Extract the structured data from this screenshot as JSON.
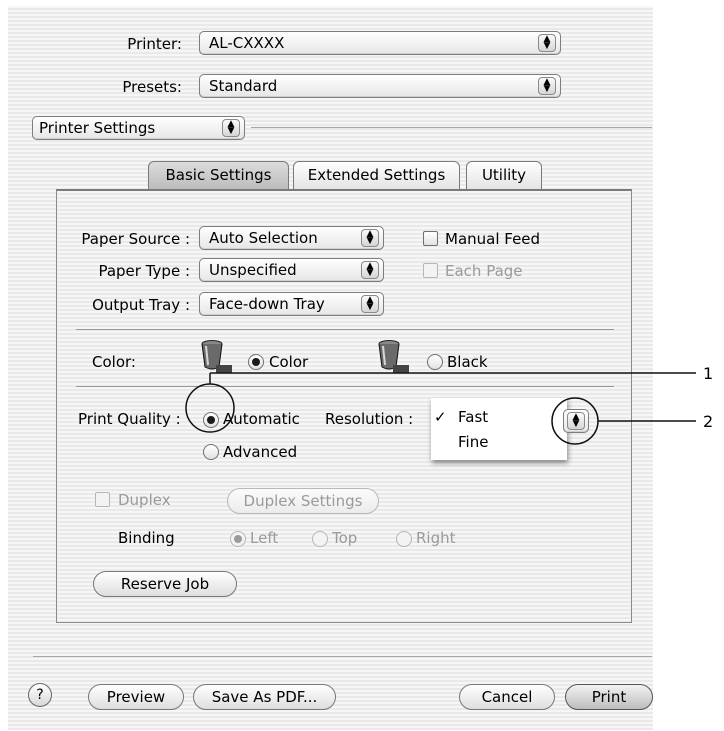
{
  "printer": {
    "label": "Printer:",
    "value": "AL-CXXXX"
  },
  "presets": {
    "label": "Presets:",
    "value": "Standard"
  },
  "section_popup": {
    "value": "Printer Settings"
  },
  "tabs": [
    {
      "label": "Basic Settings",
      "active": true
    },
    {
      "label": "Extended Settings",
      "active": false
    },
    {
      "label": "Utility",
      "active": false
    }
  ],
  "paper_source": {
    "label": "Paper Source :",
    "value": "Auto Selection"
  },
  "paper_type": {
    "label": "Paper Type :",
    "value": "Unspecified"
  },
  "output_tray": {
    "label": "Output Tray :",
    "value": "Face-down Tray"
  },
  "manual_feed": {
    "label": "Manual Feed",
    "checked": false
  },
  "each_page": {
    "label": "Each Page",
    "checked": false,
    "enabled": false
  },
  "color": {
    "label": "Color:",
    "options": [
      {
        "label": "Color",
        "selected": true
      },
      {
        "label": "Black",
        "selected": false
      }
    ]
  },
  "print_quality": {
    "label": "Print Quality :",
    "options": [
      {
        "label": "Automatic",
        "selected": true
      },
      {
        "label": "Advanced",
        "selected": false
      }
    ]
  },
  "resolution": {
    "label": "Resolution :",
    "menu_items": [
      {
        "label": "Fast",
        "checked": true,
        "checkmark": "✓"
      },
      {
        "label": "Fine",
        "checked": false
      }
    ]
  },
  "duplex": {
    "label": "Duplex",
    "checked": false,
    "enabled": false
  },
  "duplex_settings_label": "Duplex Settings",
  "binding": {
    "label": "Binding",
    "options": [
      {
        "label": "Left",
        "selected": true
      },
      {
        "label": "Top",
        "selected": false
      },
      {
        "label": "Right",
        "selected": false
      }
    ]
  },
  "reserve_job_label": "Reserve Job",
  "footer": {
    "help": "?",
    "preview": "Preview",
    "save_as_pdf": "Save As PDF...",
    "cancel": "Cancel",
    "print": "Print"
  },
  "callouts": [
    "1",
    "2"
  ],
  "icons": {
    "popup_arrows": "⬍",
    "ink_cup": "ink-cup-icon"
  }
}
